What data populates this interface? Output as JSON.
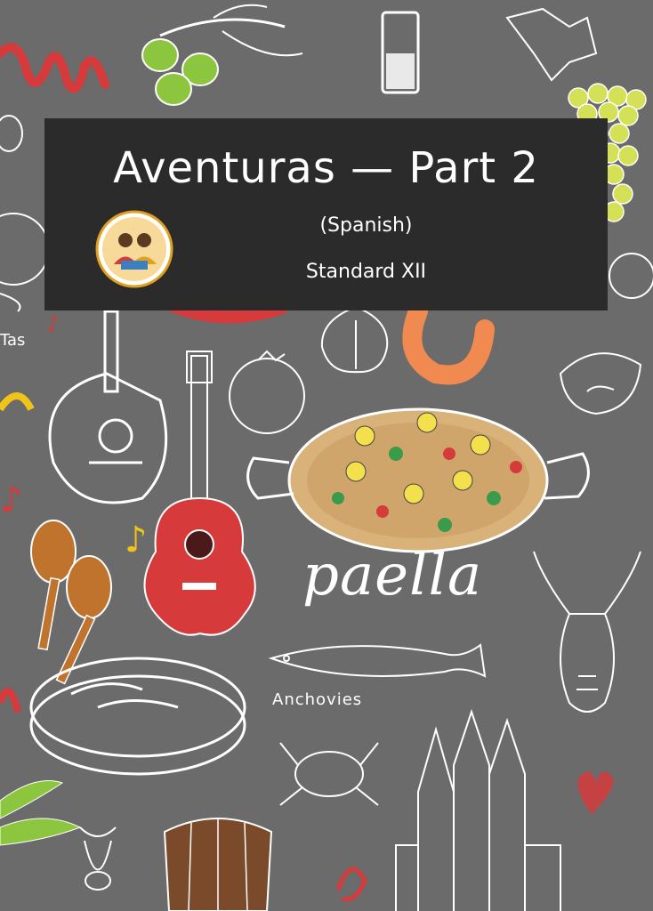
{
  "book": {
    "title": "Aventuras — Part 2",
    "subtitle": "(Spanish)",
    "standard": "Standard XII"
  },
  "illustration_labels": {
    "paella": "paella",
    "anchovies": "Anchovies"
  },
  "colors": {
    "background": "#6b6b6b",
    "panel": "#2b2b2b",
    "text": "#ffffff",
    "accent_red": "#d63a3a",
    "accent_yellow": "#f0c419",
    "olive_green": "#8cc63f"
  }
}
